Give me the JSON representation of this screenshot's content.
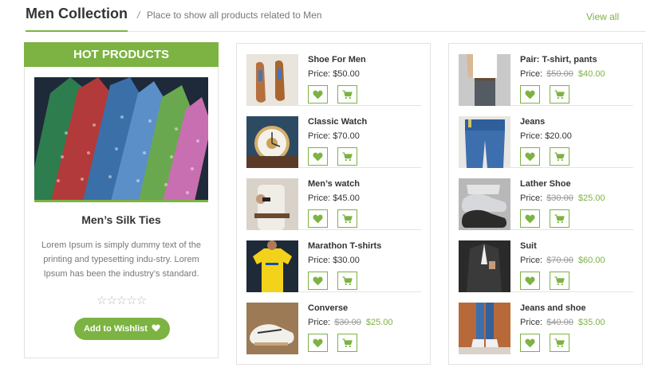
{
  "header": {
    "title": "Men Collection",
    "separator": "/",
    "description": "Place to show all products related to Men",
    "view_all": "View all"
  },
  "hot": {
    "banner": "HOT PRODUCTS",
    "name": "Men’s Silk Ties",
    "description": "Lorem Ipsum is simply dummy text of the printing and typesetting indu-stry. Lorem Ipsum has been the industry’s standard.",
    "rating": "☆☆☆☆☆",
    "rating_value": 0,
    "wishlist_label": "Add to Wishlist"
  },
  "price_label": "Price:",
  "columns": [
    {
      "products": [
        {
          "name": "Shoe For Men",
          "price": "$50.00",
          "old_price": "",
          "new_price": ""
        },
        {
          "name": "Classic Watch",
          "price": "$70.00",
          "old_price": "",
          "new_price": ""
        },
        {
          "name": "Men’s watch",
          "price": "$45.00",
          "old_price": "",
          "new_price": ""
        },
        {
          "name": "Marathon T-shirts",
          "price": "$30.00",
          "old_price": "",
          "new_price": ""
        },
        {
          "name": "Converse",
          "price": "",
          "old_price": "$30.00",
          "new_price": "$25.00"
        }
      ]
    },
    {
      "products": [
        {
          "name": "Pair: T-shirt, pants",
          "price": "",
          "old_price": "$50.00",
          "new_price": "$40.00"
        },
        {
          "name": "Jeans",
          "price": "$20.00",
          "old_price": "",
          "new_price": ""
        },
        {
          "name": "Lather Shoe",
          "price": "",
          "old_price": "$30.00",
          "new_price": "$25.00"
        },
        {
          "name": "Suit",
          "price": "",
          "old_price": "$70.00",
          "new_price": "$60.00"
        },
        {
          "name": "Jeans and shoe",
          "price": "",
          "old_price": "$40.00",
          "new_price": "$35.00"
        }
      ]
    }
  ],
  "colors": {
    "accent": "#7cb342",
    "border": "#e2e2e2",
    "text": "#333333",
    "muted": "#777777"
  },
  "icons": {
    "wishlist": "heart-icon",
    "cart": "cart-icon",
    "rating": "star-icon"
  }
}
